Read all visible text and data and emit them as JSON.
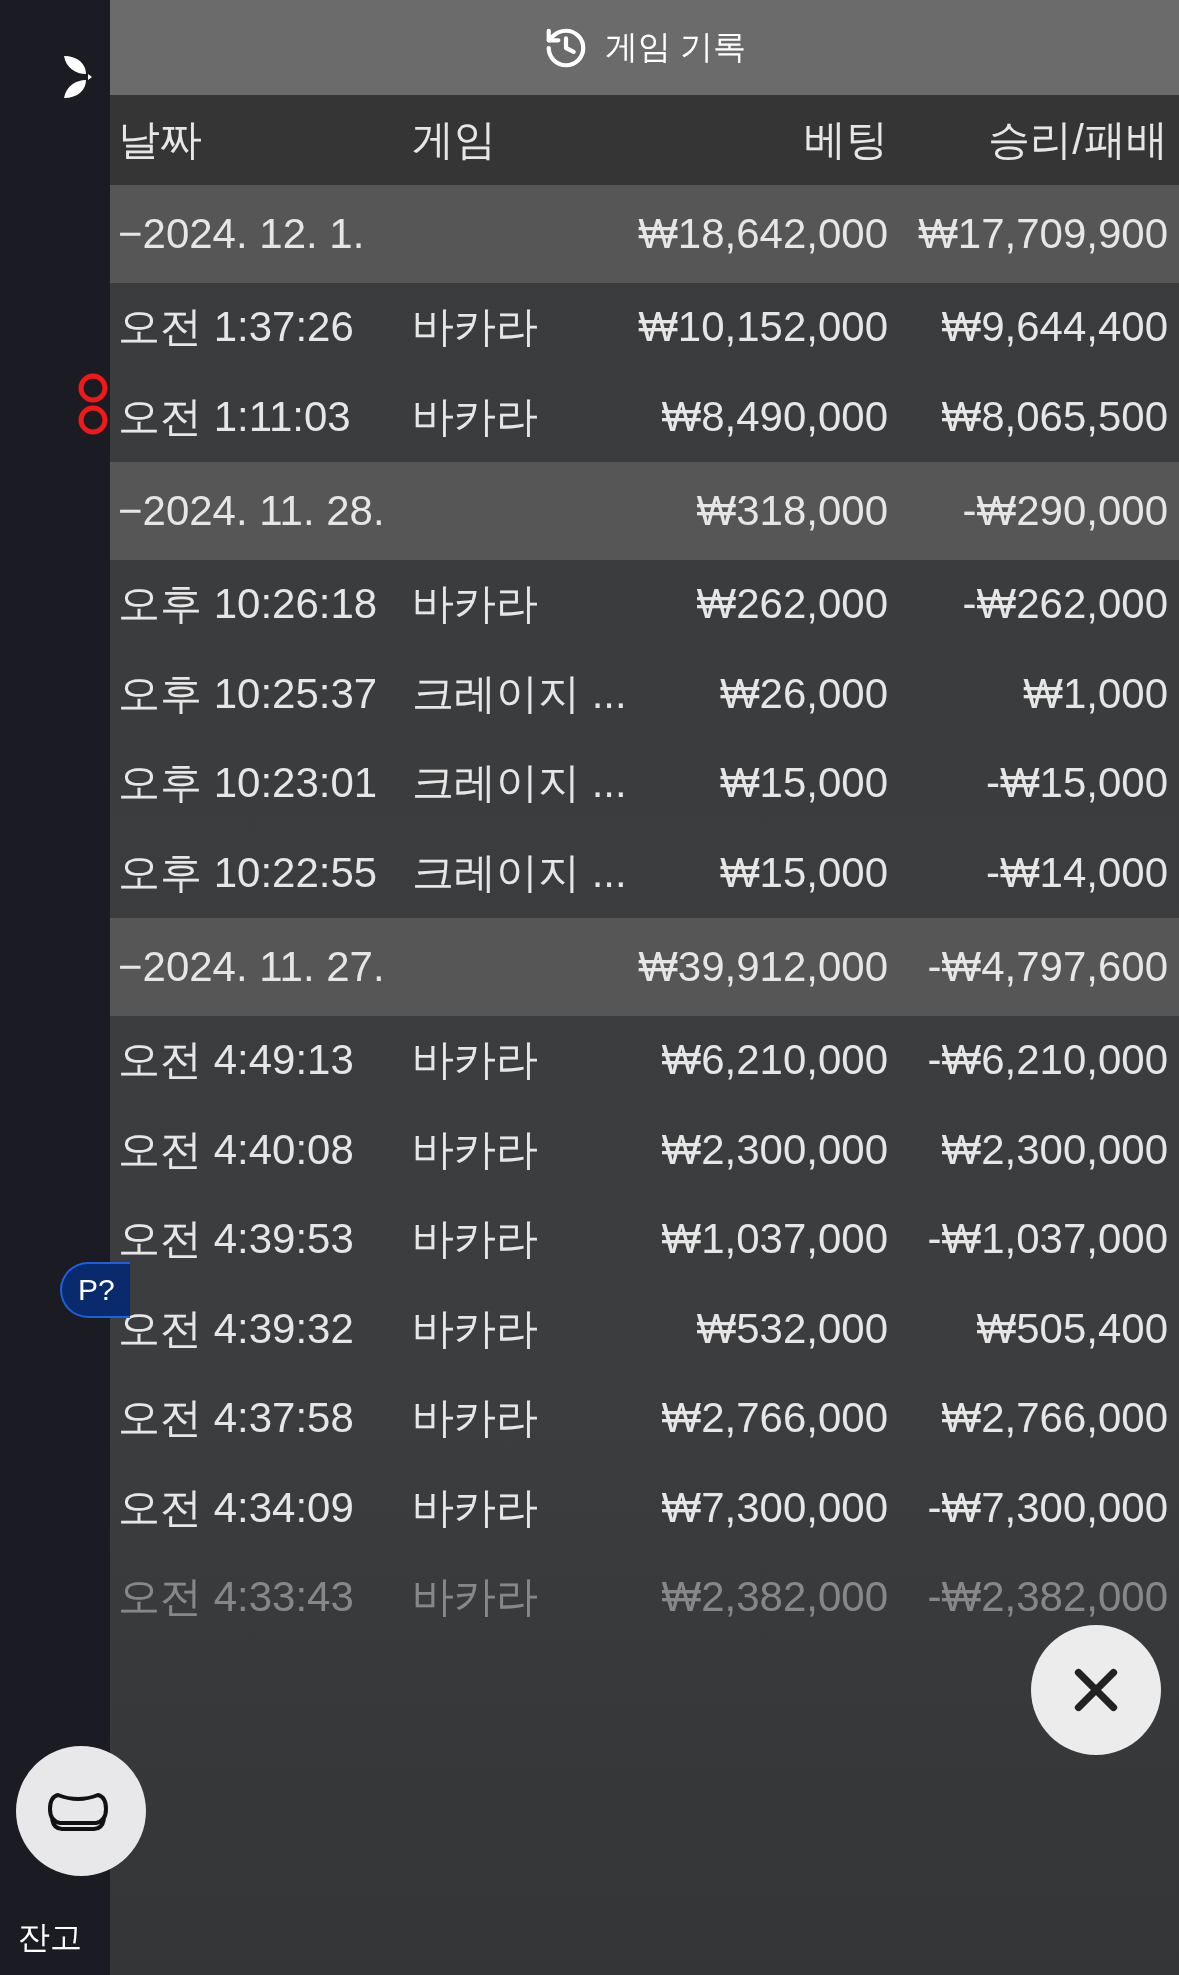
{
  "background": {
    "balance_label": "잔고",
    "badge": "P?"
  },
  "header": {
    "title": "게임 기록"
  },
  "columns": [
    "날짜",
    "게임",
    "베팅",
    "승리/패배"
  ],
  "groups": [
    {
      "date": "−2024. 12. 1.",
      "bet": "₩18,642,000",
      "result": "₩17,709,900",
      "rows": [
        {
          "time": "오전 1:37:26",
          "game": "바카라",
          "bet": "₩10,152,000",
          "result": "₩9,644,400"
        },
        {
          "time": "오전 1:11:03",
          "game": "바카라",
          "bet": "₩8,490,000",
          "result": "₩8,065,500"
        }
      ]
    },
    {
      "date": "−2024. 11. 28.",
      "bet": "₩318,000",
      "result": "-₩290,000",
      "rows": [
        {
          "time": "오후 10:26:18",
          "game": "바카라",
          "bet": "₩262,000",
          "result": "-₩262,000"
        },
        {
          "time": "오후 10:25:37",
          "game": "크레이지 ...",
          "bet": "₩26,000",
          "result": "₩1,000"
        },
        {
          "time": "오후 10:23:01",
          "game": "크레이지 ...",
          "bet": "₩15,000",
          "result": "-₩15,000"
        },
        {
          "time": "오후 10:22:55",
          "game": "크레이지 ...",
          "bet": "₩15,000",
          "result": "-₩14,000"
        }
      ]
    },
    {
      "date": "−2024. 11. 27.",
      "bet": "₩39,912,000",
      "result": "-₩4,797,600",
      "rows": [
        {
          "time": "오전 4:49:13",
          "game": "바카라",
          "bet": "₩6,210,000",
          "result": "-₩6,210,000"
        },
        {
          "time": "오전 4:40:08",
          "game": "바카라",
          "bet": "₩2,300,000",
          "result": "₩2,300,000"
        },
        {
          "time": "오전 4:39:53",
          "game": "바카라",
          "bet": "₩1,037,000",
          "result": "-₩1,037,000"
        },
        {
          "time": "오전 4:39:32",
          "game": "바카라",
          "bet": "₩532,000",
          "result": "₩505,400"
        },
        {
          "time": "오전 4:37:58",
          "game": "바카라",
          "bet": "₩2,766,000",
          "result": "₩2,766,000"
        },
        {
          "time": "오전 4:34:09",
          "game": "바카라",
          "bet": "₩7,300,000",
          "result": "-₩7,300,000"
        },
        {
          "time": "오전 4:33:43",
          "game": "바카라",
          "bet": "₩2,382,000",
          "result": "-₩2,382,000"
        }
      ]
    }
  ]
}
